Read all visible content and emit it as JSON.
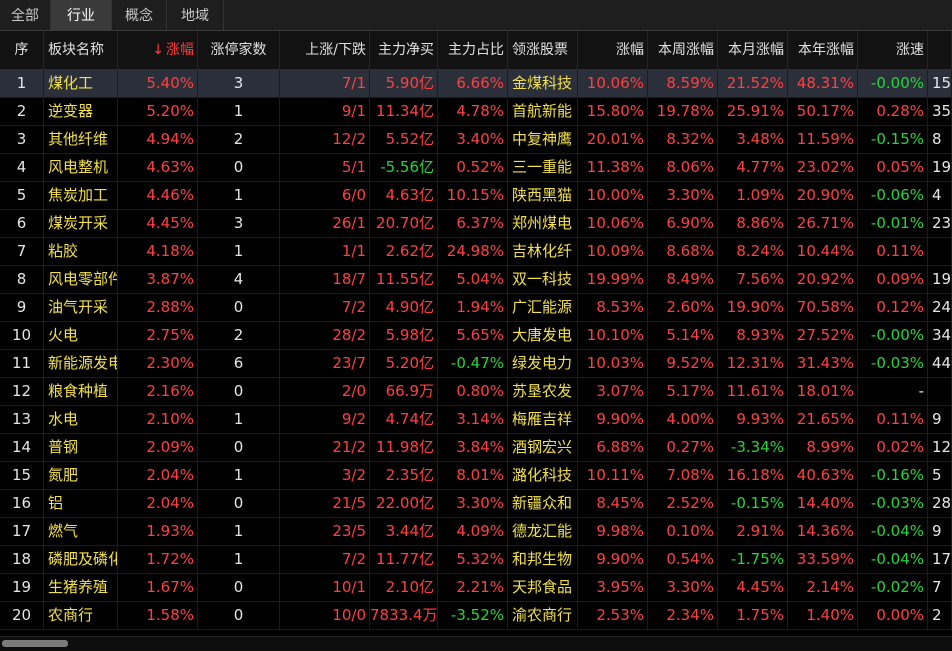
{
  "tabs": [
    "全部",
    "行业",
    "概念",
    "地域"
  ],
  "active_tab": 1,
  "columns": [
    "序",
    "板块名称",
    "涨幅",
    "涨停家数",
    "上涨/下跌",
    "主力净买",
    "主力占比",
    "领涨股票",
    "涨幅",
    "本周涨幅",
    "本月涨幅",
    "本年涨幅",
    "涨速",
    ""
  ],
  "sort_arrow": "↓",
  "rows": [
    [
      "1",
      "煤化工",
      "5.40%",
      "3",
      "7/1",
      "5.90亿",
      "6.66%",
      "金煤科技",
      "10.06%",
      "8.59%",
      "21.52%",
      "48.31%",
      "-0.00%",
      "15"
    ],
    [
      "2",
      "逆变器",
      "5.20%",
      "1",
      "9/1",
      "11.34亿",
      "4.78%",
      "首航新能",
      "15.80%",
      "19.78%",
      "25.91%",
      "50.17%",
      "0.28%",
      "35"
    ],
    [
      "3",
      "其他纤维",
      "4.94%",
      "2",
      "12/2",
      "5.52亿",
      "3.40%",
      "中复神鹰",
      "20.01%",
      "8.32%",
      "3.48%",
      "11.59%",
      "-0.15%",
      "8"
    ],
    [
      "4",
      "风电整机",
      "4.63%",
      "0",
      "5/1",
      "-5.56亿",
      "0.52%",
      "三一重能",
      "11.38%",
      "8.06%",
      "4.77%",
      "23.02%",
      "0.05%",
      "19"
    ],
    [
      "5",
      "焦炭加工",
      "4.46%",
      "1",
      "6/0",
      "4.63亿",
      "10.15%",
      "陕西黑猫",
      "10.00%",
      "3.30%",
      "1.09%",
      "20.90%",
      "-0.06%",
      "4"
    ],
    [
      "6",
      "煤炭开采",
      "4.45%",
      "3",
      "26/1",
      "20.70亿",
      "6.37%",
      "郑州煤电",
      "10.06%",
      "6.90%",
      "8.86%",
      "26.71%",
      "-0.01%",
      "23"
    ],
    [
      "7",
      "粘胶",
      "4.18%",
      "1",
      "1/1",
      "2.62亿",
      "24.98%",
      "吉林化纤",
      "10.09%",
      "8.68%",
      "8.24%",
      "10.44%",
      "0.11%",
      ""
    ],
    [
      "8",
      "风电零部件",
      "3.87%",
      "4",
      "18/7",
      "11.55亿",
      "5.04%",
      "双一科技",
      "19.99%",
      "8.49%",
      "7.56%",
      "20.92%",
      "0.09%",
      "19"
    ],
    [
      "9",
      "油气开采",
      "2.88%",
      "0",
      "7/2",
      "4.90亿",
      "1.94%",
      "广汇能源",
      "8.53%",
      "2.60%",
      "19.90%",
      "70.58%",
      "0.12%",
      "24"
    ],
    [
      "10",
      "火电",
      "2.75%",
      "2",
      "28/2",
      "5.98亿",
      "5.65%",
      "大唐发电",
      "10.10%",
      "5.14%",
      "8.93%",
      "27.52%",
      "-0.00%",
      "34"
    ],
    [
      "11",
      "新能源发电",
      "2.30%",
      "6",
      "23/7",
      "5.20亿",
      "-0.47%",
      "绿发电力",
      "10.03%",
      "9.52%",
      "12.31%",
      "31.43%",
      "-0.03%",
      "44"
    ],
    [
      "12",
      "粮食种植",
      "2.16%",
      "0",
      "2/0",
      "66.9万",
      "0.80%",
      "苏垦农发",
      "3.07%",
      "5.17%",
      "11.61%",
      "18.01%",
      "-",
      ""
    ],
    [
      "13",
      "水电",
      "2.10%",
      "1",
      "9/2",
      "4.74亿",
      "3.14%",
      "梅雁吉祥",
      "9.90%",
      "4.00%",
      "9.93%",
      "21.65%",
      "0.11%",
      "9"
    ],
    [
      "14",
      "普钢",
      "2.09%",
      "0",
      "21/2",
      "11.98亿",
      "3.84%",
      "酒钢宏兴",
      "6.88%",
      "0.27%",
      "-3.34%",
      "8.99%",
      "0.02%",
      "12"
    ],
    [
      "15",
      "氮肥",
      "2.04%",
      "1",
      "3/2",
      "2.35亿",
      "8.01%",
      "潞化科技",
      "10.11%",
      "7.08%",
      "16.18%",
      "40.63%",
      "-0.16%",
      "5"
    ],
    [
      "16",
      "铝",
      "2.04%",
      "0",
      "21/5",
      "22.00亿",
      "3.30%",
      "新疆众和",
      "8.45%",
      "2.52%",
      "-0.15%",
      "14.40%",
      "-0.03%",
      "28"
    ],
    [
      "17",
      "燃气",
      "1.93%",
      "1",
      "23/5",
      "3.44亿",
      "4.09%",
      "德龙汇能",
      "9.98%",
      "0.10%",
      "2.91%",
      "14.36%",
      "-0.04%",
      "9"
    ],
    [
      "18",
      "磷肥及磷化工",
      "1.72%",
      "1",
      "7/2",
      "11.77亿",
      "5.32%",
      "和邦生物",
      "9.90%",
      "0.54%",
      "-1.75%",
      "33.59%",
      "-0.04%",
      "17"
    ],
    [
      "19",
      "生猪养殖",
      "1.67%",
      "0",
      "10/1",
      "2.10亿",
      "2.21%",
      "天邦食品",
      "3.95%",
      "3.30%",
      "4.45%",
      "2.14%",
      "-0.02%",
      "7"
    ],
    [
      "20",
      "农商行",
      "1.58%",
      "0",
      "10/0",
      "7833.4万",
      "-3.52%",
      "渝农商行",
      "2.53%",
      "2.34%",
      "1.75%",
      "1.40%",
      "0.00%",
      "2"
    ]
  ]
}
